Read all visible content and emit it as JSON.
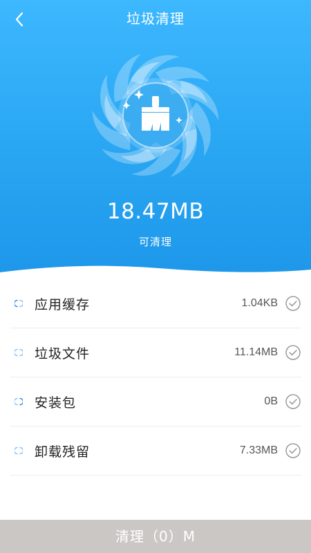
{
  "header": {
    "back_icon": "chevron-left-icon",
    "title": "垃圾清理"
  },
  "hero": {
    "icon": "broom-icon",
    "total_size": "18.47MB",
    "subtitle": "可清理"
  },
  "items": [
    {
      "label": "应用缓存",
      "value": "1.04KB",
      "checked": true
    },
    {
      "label": "垃圾文件",
      "value": "11.14MB",
      "checked": true
    },
    {
      "label": "安装包",
      "value": "0B",
      "checked": true
    },
    {
      "label": "卸载残留",
      "value": "7.33MB",
      "checked": true
    }
  ],
  "footer": {
    "clean_button": "清理（0）M"
  },
  "colors": {
    "hero_top": "#3db8ff",
    "hero_bottom": "#1e97ea",
    "button_bg": "#cbc7c5",
    "check_gray": "#9a9a9a",
    "spinner_blue": "#3a8ee6"
  }
}
